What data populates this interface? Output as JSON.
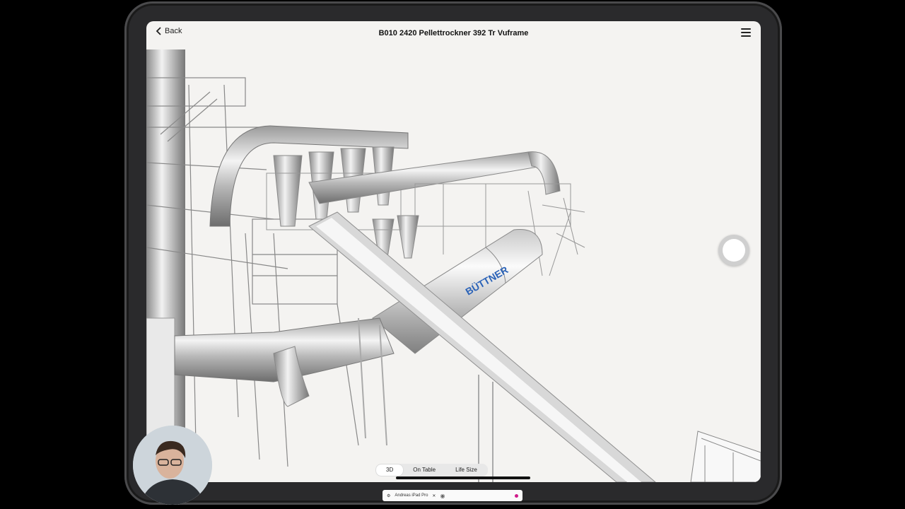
{
  "app": {
    "back_label": "Back",
    "title": "B010 2420 Pellettrockner 392 Tr Vuframe"
  },
  "model": {
    "brand_text": "BÜTTNER"
  },
  "view_modes": {
    "items": [
      "3D",
      "On Table",
      "Life Size"
    ],
    "selected": "3D"
  },
  "recording_bar": {
    "device_label": "Andreas iPad Pro",
    "close_glyph": "✕"
  },
  "colors": {
    "accent_record": "#d01b8a",
    "background": "#f4f3f1"
  },
  "icons": {
    "back": "chevron-left-icon",
    "menu": "hamburger-menu-icon",
    "camera": "camera-icon",
    "settings": "gear-icon"
  }
}
